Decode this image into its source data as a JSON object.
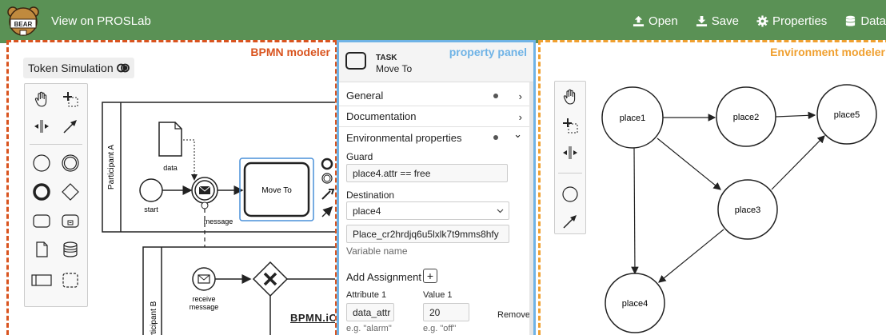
{
  "nav": {
    "title": "View on PROSLab",
    "logo_text": "BEAR",
    "items": [
      {
        "label": "Open",
        "icon": "upload-icon"
      },
      {
        "label": "Save",
        "icon": "download-icon"
      },
      {
        "label": "Properties",
        "icon": "gear-icon"
      },
      {
        "label": "Data",
        "icon": "database-icon"
      }
    ]
  },
  "bpmn": {
    "title": "BPMN modeler",
    "token_simulation": "Token Simulation",
    "elements": {
      "participant_a": "Participant A",
      "participant_b": "Participant B",
      "data": "data",
      "start": "start",
      "message": "message",
      "task": "Move To",
      "receive_message": "receive\nmessage",
      "receive_line1": "receive",
      "receive_line2": "message"
    },
    "watermark": "BPMN.iO"
  },
  "property_panel": {
    "title": "property panel",
    "element_type": "TASK",
    "element_name": "Move To",
    "groups": [
      {
        "label": "General",
        "has_dot": true,
        "chevron": "›"
      },
      {
        "label": "Documentation",
        "has_dot": false,
        "chevron": "›"
      },
      {
        "label": "Environmental properties",
        "has_dot": true,
        "chevron": "⌄"
      }
    ],
    "guard_label": "Guard",
    "guard_value": "place4.attr == free",
    "destination_label": "Destination",
    "destination_value": "place4",
    "variable_value": "Place_cr2hrdjq6u5lxlk7t9mms8hfy",
    "variable_label": "Variable name",
    "add_assignment": "Add Assignment",
    "add_button": "+",
    "attribute_label": "Attribute 1",
    "value_label": "Value 1",
    "attribute_value": "data_attr",
    "value_value": "20",
    "remove": "Remove",
    "attribute_hint": "e.g. \"alarm\"",
    "value_hint": "e.g. \"off\""
  },
  "env": {
    "title": "Environment modeler",
    "places": [
      "place1",
      "place2",
      "place5",
      "place3",
      "place4"
    ]
  }
}
